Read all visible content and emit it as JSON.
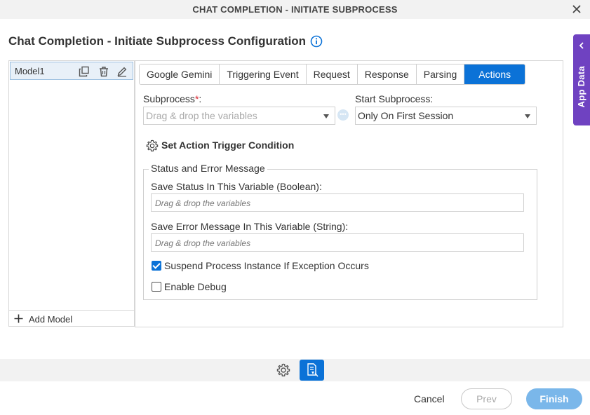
{
  "window": {
    "title": "CHAT COMPLETION - INITIATE SUBPROCESS"
  },
  "page": {
    "title": "Chat Completion - Initiate Subprocess Configuration"
  },
  "app_data": {
    "label": "App Data"
  },
  "models": {
    "items": [
      {
        "name": "Model1"
      }
    ],
    "add_label": "Add Model"
  },
  "tabs": [
    {
      "label": "Google Gemini",
      "active": false
    },
    {
      "label": "Triggering Event",
      "active": false
    },
    {
      "label": "Request",
      "active": false
    },
    {
      "label": "Response",
      "active": false
    },
    {
      "label": "Parsing",
      "active": false
    },
    {
      "label": "Actions",
      "active": true
    }
  ],
  "form": {
    "subprocess_label": "Subprocess",
    "subprocess_required": "*",
    "subprocess_colon": ":",
    "subprocess_placeholder": "Drag & drop the variables",
    "start_label": "Start Subprocess:",
    "start_value": "Only On First Session",
    "trigger_label": "Set Action Trigger Condition",
    "status_group": "Status and Error Message",
    "status_var_label": "Save Status In This Variable (Boolean):",
    "status_var_placeholder": "Drag & drop the variables",
    "error_var_label": "Save Error Message In This Variable (String):",
    "error_var_placeholder": "Drag & drop the variables",
    "suspend_label": "Suspend Process Instance If Exception Occurs",
    "suspend_checked": true,
    "debug_label": "Enable Debug",
    "debug_checked": false
  },
  "footer": {
    "cancel": "Cancel",
    "prev": "Prev",
    "finish": "Finish"
  },
  "colors": {
    "accent": "#0b72d7",
    "app_data": "#6f42c1",
    "finish_disabled": "#7ab7ea"
  }
}
